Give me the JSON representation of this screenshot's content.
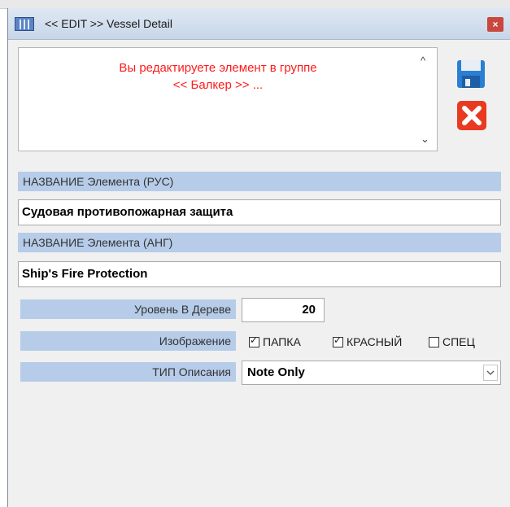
{
  "window": {
    "title": "<< EDIT >> Vessel Detail",
    "close_label": "×"
  },
  "message": {
    "line1": "Вы редактируете элемент в группе",
    "line2": "<< Балкер >> ..."
  },
  "scrollbar": {
    "up": "^",
    "down": "⌄"
  },
  "fields": {
    "name_ru_header": "НАЗВАНИЕ Элемента (РУС)",
    "name_ru_value": "Судовая противопожарная защита",
    "name_en_header": "НАЗВАНИЕ Элемента (АНГ)",
    "name_en_value": "Ship's Fire Protection",
    "level_label": "Уровень В Дереве",
    "level_value": "20",
    "image_label": "Изображение",
    "desc_type_label": "ТИП Описания",
    "desc_type_value": "Note Only"
  },
  "checkboxes": [
    {
      "label": "ПАПКА",
      "checked": true
    },
    {
      "label": "КРАСНЫЙ",
      "checked": true
    },
    {
      "label": "СПЕЦ",
      "checked": false
    }
  ],
  "icons": {
    "title": "app-window-icon",
    "save": "floppy-disk-icon",
    "cancel": "red-x-icon",
    "combo_arrow": "chevron-down-icon"
  },
  "colors": {
    "section_bg": "#b6cce9",
    "message_text": "#ff1a1a",
    "close_bg": "#c9473d",
    "save_blue": "#2a7fd4",
    "cancel_red": "#e83a20"
  }
}
